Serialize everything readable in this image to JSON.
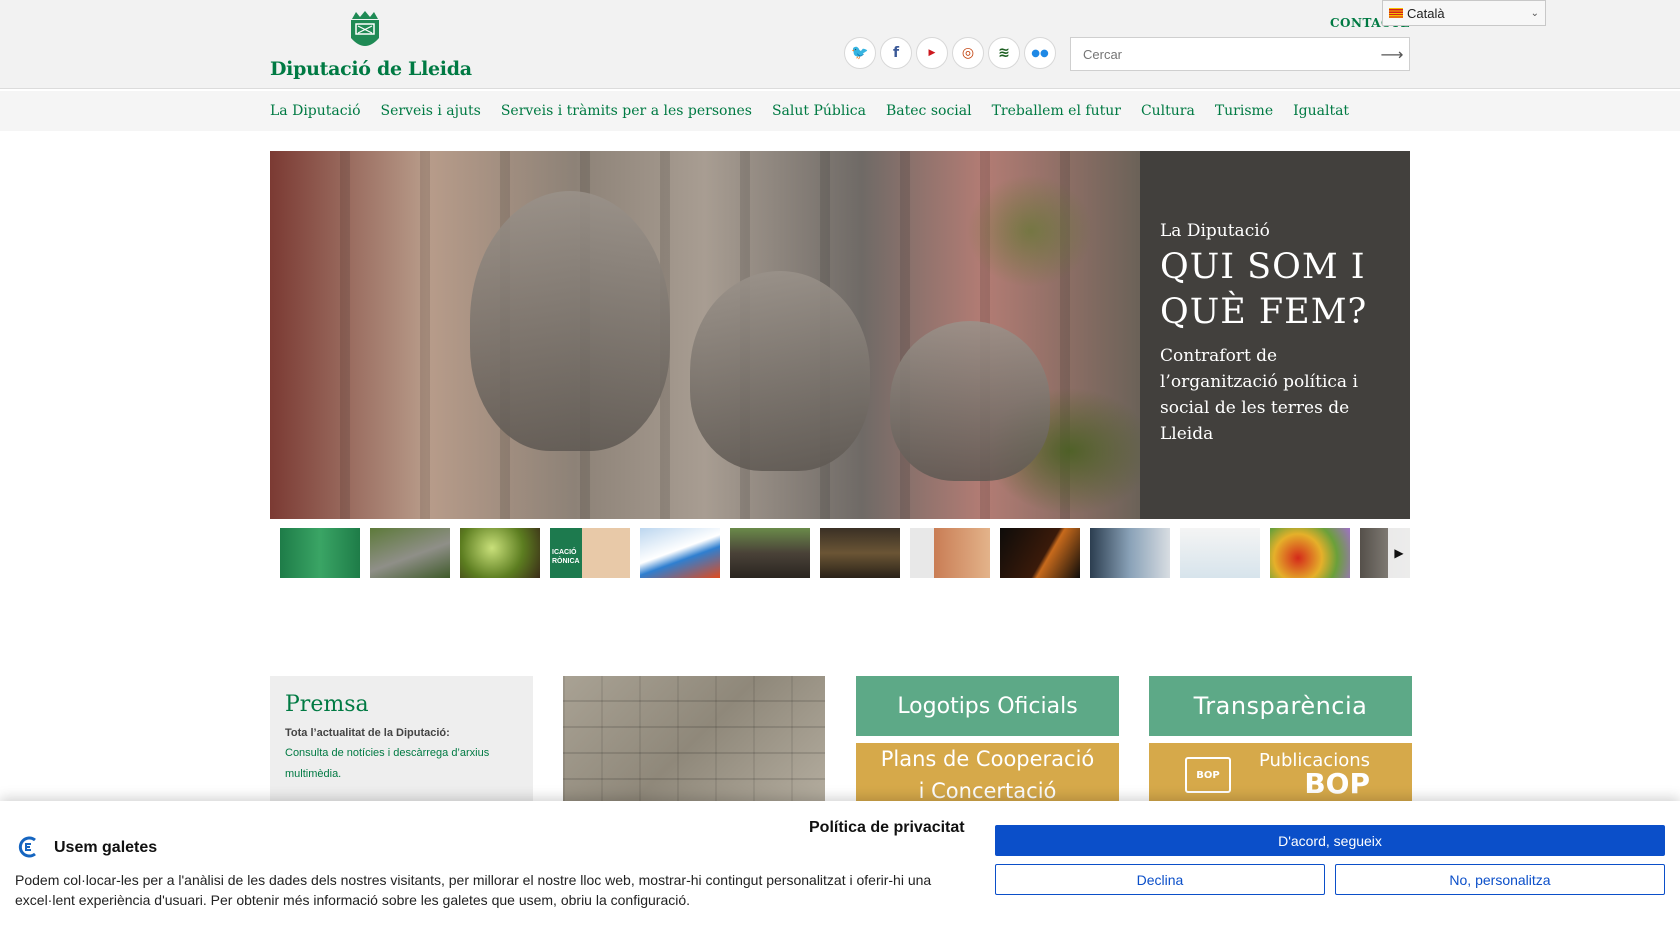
{
  "header": {
    "site_name": "Diputació de Lleida",
    "contact_label": "CONTACTE",
    "language": {
      "selected": "Català"
    },
    "search": {
      "placeholder": "Cercar",
      "submit_icon": "arrow-right-icon"
    },
    "social": [
      {
        "name": "twitter",
        "glyph": "🐦"
      },
      {
        "name": "facebook",
        "glyph": "f"
      },
      {
        "name": "youtube",
        "glyph": "You Tube"
      },
      {
        "name": "instagram",
        "glyph": "◎"
      },
      {
        "name": "rss",
        "glyph": "≋"
      },
      {
        "name": "flickr",
        "glyph": "●●"
      }
    ]
  },
  "nav": {
    "items": [
      "La Diputació",
      "Serveis i ajuts",
      "Serveis i tràmits per a les persones",
      "Salut Pública",
      "Batec social",
      "Treballem el futur",
      "Cultura",
      "Turisme",
      "Igualtat"
    ]
  },
  "hero": {
    "kicker": "La Diputació",
    "title": "QUI SOM I QUÈ FEM?",
    "description": "Contrafort de l’organització política i social de les terres de Lleida"
  },
  "carousel": {
    "thumb_count": 13,
    "next_icon": "play-right-icon",
    "visible_text": "ICACIÓ RÒNICA"
  },
  "premsa": {
    "title": "Premsa",
    "subtitle": "Tota l’actualitat de la Diputació:",
    "link": "Consulta de notícies i descàrrega d’arxius multimèdia."
  },
  "tiles": {
    "logotips": "Logotips Oficials",
    "transparencia": "Transparència",
    "plans_line1": "Plans de Cooperació",
    "plans_line2": "i Concertació",
    "bop_line1": "Publicacions",
    "bop_line2": "BOP",
    "bop_icon_label": "BOP"
  },
  "cookie": {
    "title": "Usem galetes",
    "policy_link": "Política de privacitat",
    "text": "Podem col·locar-les per a l'anàlisi de les dades dels nostres visitants, per millorar el nostre lloc web, mostrar-hi contingut personalitzat i oferir-hi una excel·lent experiència d'usuari. Per obtenir més informació sobre les galetes que usem, obriu la configuració.",
    "accept": "D'acord, segueix",
    "decline": "Declina",
    "customize": "No, personalitza"
  },
  "colors": {
    "brand_green": "#007a43",
    "tile_green": "#5da987",
    "tile_gold": "#d6a94a",
    "cookie_blue": "#0b4fc9"
  }
}
